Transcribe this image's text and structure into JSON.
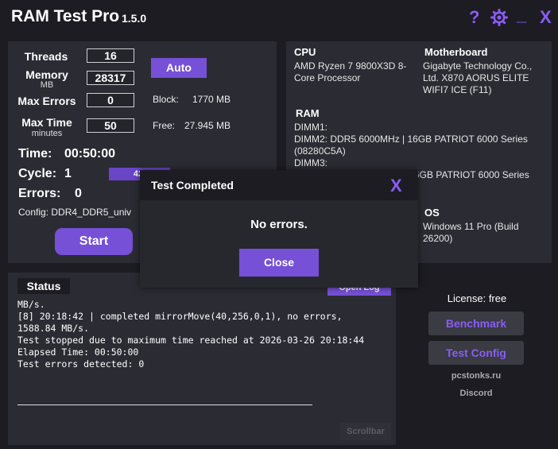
{
  "app": {
    "title": "RAM Test Pro",
    "version": "1.5.0"
  },
  "titlebar": {
    "help": "?",
    "minimize": "_",
    "close": "X"
  },
  "settings": {
    "threads_label": "Threads",
    "threads_value": "16",
    "memory_label": "Memory",
    "memory_unit": "MB",
    "memory_value": "28317",
    "max_errors_label": "Max Errors",
    "max_errors_value": "0",
    "max_time_label": "Max Time",
    "max_time_unit": "minutes",
    "max_time_value": "50",
    "auto_button": "Auto",
    "block_label": "Block:",
    "block_value": "1770 MB",
    "free_label": "Free:",
    "free_value": "27.945 MB"
  },
  "stats": {
    "time_label": "Time:",
    "time_value": "00:50:00",
    "cycle_label": "Cycle:",
    "cycle_value": "1",
    "progress_text": "42/",
    "errors_label": "Errors:",
    "errors_value": "0",
    "config_text": "Config: DDR4_DDR5_univ",
    "start_button": "Start"
  },
  "hardware": {
    "cpu_label": "CPU",
    "cpu_line1": "AMD Ryzen 7 9800X3D 8-",
    "cpu_line2": "Core Processor",
    "mb_label": "Motherboard",
    "mb_line1": "Gigabyte Technology Co.,",
    "mb_line2": "Ltd. X870 AORUS ELITE",
    "mb_line3": "WIFI7 ICE (F11)",
    "ram_label": "RAM",
    "ram_line1": "DIMM1:",
    "ram_line2": "DIMM2: DDR5 6000MHz | 16GB PATRIOT 6000 Series",
    "ram_line3": "(08280C5A)",
    "ram_line4": "DIMM3:",
    "ram_line5": "6GB PATRIOT 6000 Series",
    "os_label": "OS",
    "os_line1": "Windows 11 Pro (Build",
    "os_line2": "26200)"
  },
  "status": {
    "label": "Status",
    "open_log_button": "Open Log",
    "lines": [
      "MB/s.",
      "[8] 20:18:42 | completed mirrorMove(40,256,0,1), no errors,",
      "1588.84 MB/s.",
      "",
      "",
      "Test stopped due to maximum time reached at 2026-03-26 20:18:44",
      "Elapsed Time: 00:50:00",
      "Test errors detected: 0"
    ],
    "scrollbar": "Scrollbar"
  },
  "sidebar": {
    "license": "License: free",
    "benchmark_button": "Benchmark",
    "test_config_button": "Test Config",
    "site_link": "pcstonks.ru",
    "discord_link": "Discord"
  },
  "dialog": {
    "title": "Test Completed",
    "close_x": "X",
    "message": "No errors.",
    "close_button": "Close"
  }
}
